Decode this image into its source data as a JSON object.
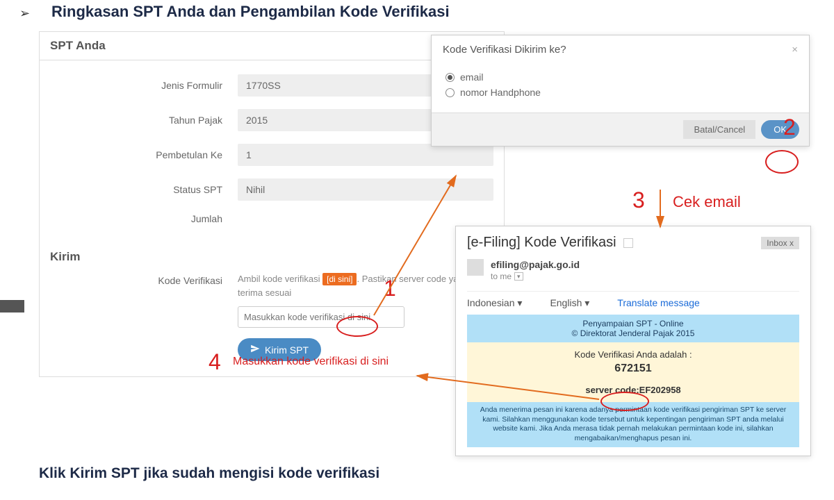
{
  "page": {
    "title": "Ringkasan SPT Anda dan Pengambilan Kode Verifikasi",
    "caption": "Klik Kirim SPT jika sudah mengisi kode verifikasi"
  },
  "panel": {
    "title": "SPT Anda",
    "fields": {
      "jenis_label": "Jenis Formulir",
      "jenis_value": "1770SS",
      "tahun_label": "Tahun Pajak",
      "tahun_value": "2015",
      "pembetulan_label": "Pembetulan Ke",
      "pembetulan_value": "1",
      "status_label": "Status SPT",
      "status_value": "Nihil",
      "jumlah_label": "Jumlah",
      "jumlah_value": ""
    },
    "kirim": {
      "section": "Kirim",
      "kv_label": "Kode Verifikasi",
      "kv_text_a": "Ambil kode verifikasi ",
      "kv_link": "[di sini]",
      "kv_text_b": ". Pastikan server code yang anda terima sesuai",
      "kv_placeholder": "Masukkan kode verifikasi di sini",
      "submit": "Kirim SPT"
    }
  },
  "modal": {
    "title": "Kode Verifikasi Dikirim ke?",
    "opt_email": "email",
    "opt_phone": "nomor Handphone",
    "cancel": "Batal/Cancel",
    "ok": "OK"
  },
  "email": {
    "subject": "[e-Filing] Kode Verifikasi",
    "inbox_tag": "Inbox   x",
    "from": "efiling@pajak.go.id",
    "to": "to me",
    "lang_id": "Indonesian",
    "lang_en": "English",
    "translate": "Translate message",
    "blue1a": "Penyampaian SPT - Online",
    "blue1b": "© Direktorat Jenderal Pajak 2015",
    "cream_a": "Kode Verifikasi Anda adalah :",
    "cream_code": "672151",
    "cream_sc": "server code:EF202958",
    "blue2": "Anda menerima pesan ini karena adanya permintaan kode verifikasi pengiriman SPT ke server kami. Silahkan menggunakan kode tersebut untuk kepentingan pengiriman SPT anda melalui website kami. Jika Anda merasa tidak pernah melakukan permintaan kode ini, silahkan mengabaikan/menghapus pesan ini."
  },
  "anno": {
    "n1": "1",
    "n2": "2",
    "n3": "3",
    "n4": "4",
    "cek": "Cek email",
    "input_hint": "Masukkan kode verifikasi di sini"
  }
}
